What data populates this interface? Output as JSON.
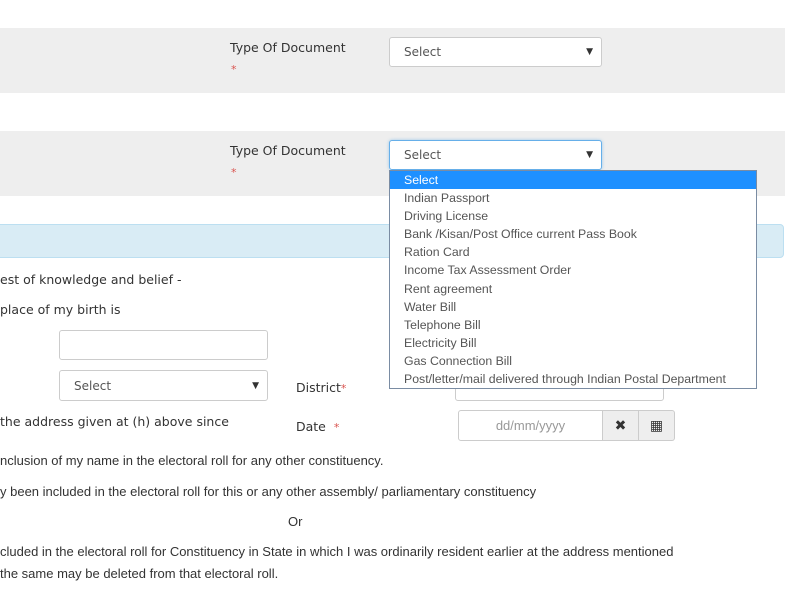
{
  "section1": {
    "label": "Type Of Document",
    "required_marker": "*",
    "select_value": "Select",
    "caret": "▼"
  },
  "section2": {
    "label": "Type Of Document",
    "required_marker": "*",
    "select_value": "Select",
    "caret": "▼",
    "dropdown_open": true,
    "options": [
      "Select",
      "Indian Passport",
      "Driving License",
      "Bank /Kisan/Post Office current Pass Book",
      "Ration Card",
      "Income Tax Assessment Order",
      "Rent agreement",
      "Water Bill",
      "Telephone Bill",
      "Electricity Bill",
      "Gas Connection Bill",
      "Post/letter/mail delivered through Indian Postal Department"
    ],
    "highlighted_option": "Select"
  },
  "declaration": {
    "line1": "est of knowledge and belief -",
    "line2": "place of my birth is",
    "birth_place_input_value": "",
    "state_select_value": "Select",
    "state_caret": "▼",
    "district_label": "District",
    "district_required": "*",
    "district_input_value": "",
    "line3": " the address given at (h) above since",
    "date_label": "Date",
    "date_required": "*",
    "date_placeholder": "dd/mm/yyyy",
    "clear_icon": "✖",
    "calendar_icon": "▦",
    "line4": "nclusion of my name in the electoral roll for any other constituency.",
    "line5": "y been included in the electoral roll for this or any other assembly/ parliamentary constituency",
    "or_text": "Or",
    "line6": "cluded in the electoral roll for Constituency in State in which I was ordinarily resident earlier at the address mentioned",
    "line7": " the same may be deleted from that electoral roll."
  }
}
